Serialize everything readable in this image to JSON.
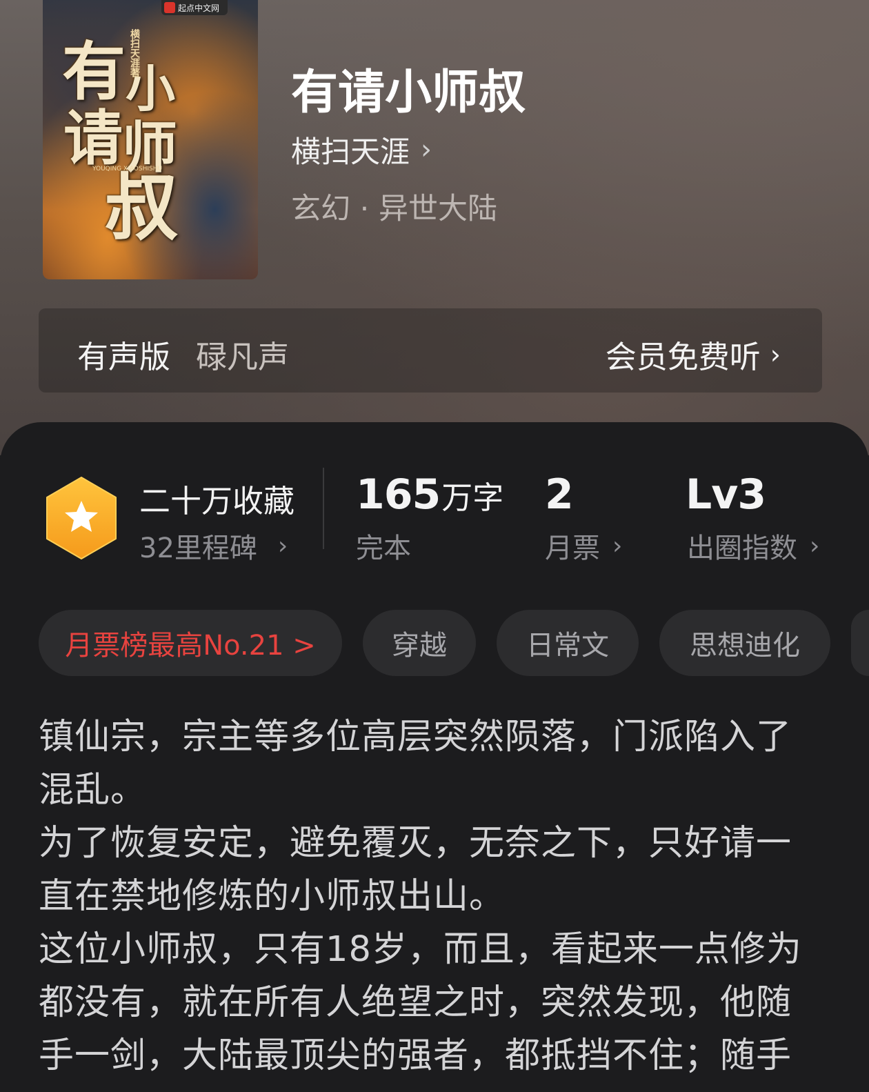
{
  "cover": {
    "publisher_logo": "起点中文网",
    "title_art": "有请小师叔",
    "author_art": "横扫天涯著",
    "english_art": "YOUQING XIAOSHISHU"
  },
  "book": {
    "title": "有请小师叔",
    "author": "横扫天涯",
    "author_chevron": "›",
    "genre": "玄幻 · 异世大陆"
  },
  "audio": {
    "label": "有声版",
    "narrator": "碌凡声",
    "action": "会员免费听",
    "chevron": "›"
  },
  "stats": {
    "collections": "二十万收藏",
    "milestones": "32里程碑",
    "chevron": "›",
    "words_number": "165",
    "words_unit": "万字",
    "status": "完本",
    "monthly_votes": "2",
    "monthly_votes_label": "月票",
    "level": "Lv3",
    "level_label": "出圈指数"
  },
  "tags": {
    "rank": "月票榜最高No.21 >",
    "items": [
      "穿越",
      "日常文",
      "思想迪化"
    ]
  },
  "description": {
    "lines": [
      "镇仙宗，宗主等多位高层突然陨落，门派陷入了混乱。",
      "为了恢复安定，避免覆灭，无奈之下，只好请一直在禁地修炼的小师叔出山。",
      "这位小师叔，只有18岁，而且，看起来一点修为都没有，就在所有人绝望之时，突然发现，他随手一剑，大陆最顶尖的强者，都抵挡不住；随手"
    ]
  },
  "colors": {
    "accent_rank": "#e8433f",
    "badge": "#f5a623",
    "card_bg": "#1c1c1e"
  },
  "icons": [
    "star-icon",
    "chevron-right-icon"
  ]
}
